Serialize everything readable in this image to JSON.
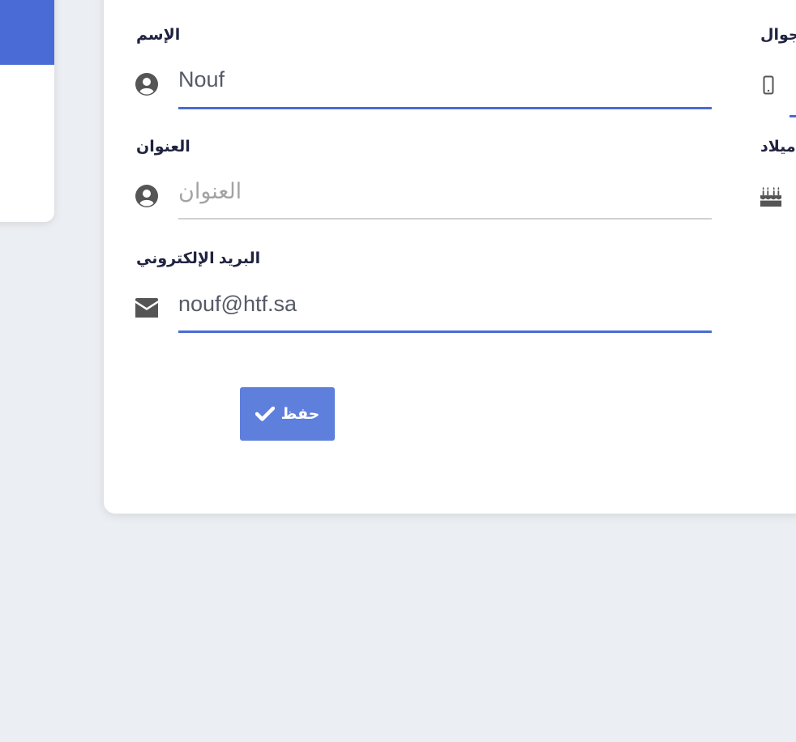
{
  "form": {
    "name": {
      "label": "الإسم",
      "value": "Nouf",
      "placeholder": "الإسم"
    },
    "address": {
      "label": "العنوان",
      "value": "",
      "placeholder": "العنوان"
    },
    "email": {
      "label": "البريد الإلكتروني",
      "value": "nouf@htf.sa",
      "placeholder": "البريد الإلكتروني"
    },
    "mobile": {
      "label": "جوال"
    },
    "birthdate": {
      "label": "ميلاد"
    },
    "save_label": "حفظ"
  },
  "colors": {
    "accent": "#4a6bd6",
    "button": "#5f7fdc",
    "label": "#202340",
    "icon": "#555555",
    "inactive_underline": "#d0d0d0",
    "background": "#ebeef2"
  },
  "icons": {
    "name": "user-circle-icon",
    "address": "user-circle-icon",
    "email": "envelope-icon",
    "mobile": "mobile-phone-icon",
    "birthdate": "birthday-cake-icon",
    "save": "check-icon"
  }
}
